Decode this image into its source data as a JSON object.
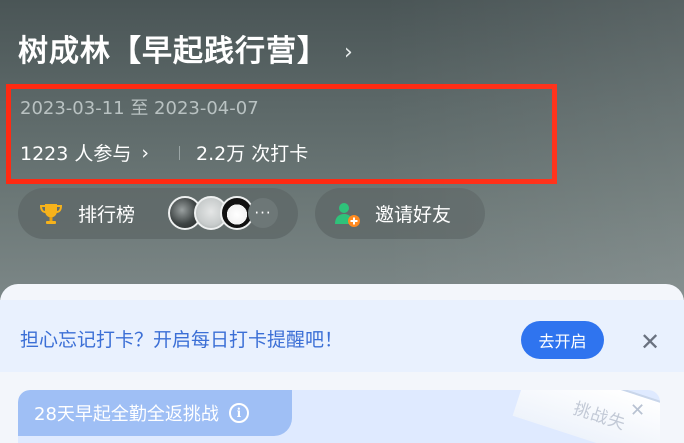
{
  "header": {
    "title": "树成林【早起践行营】",
    "title_chevron": "›",
    "date_range": "2023-03-11 至 2023-04-07",
    "participants": "1223 人参与",
    "participants_chevron": "›",
    "checkins": "2.2万 次打卡"
  },
  "actions": {
    "leaderboard_label": "排行榜",
    "avatars_more": "···",
    "invite_label": "邀请好友"
  },
  "reminder": {
    "text": "担心忘记打卡？开启每日打卡提醒吧！",
    "button_label": "去开启",
    "close_glyph": "✕"
  },
  "challenge": {
    "tag_label": "28天早起全勤全返挑战",
    "info_glyph": "i",
    "stamp_text": "挑战失",
    "close_glyph": "✕"
  },
  "colors": {
    "highlight_border": "#ff2a12",
    "accent_blue": "#2f74ef",
    "reminder_text": "#3b6fd6"
  }
}
